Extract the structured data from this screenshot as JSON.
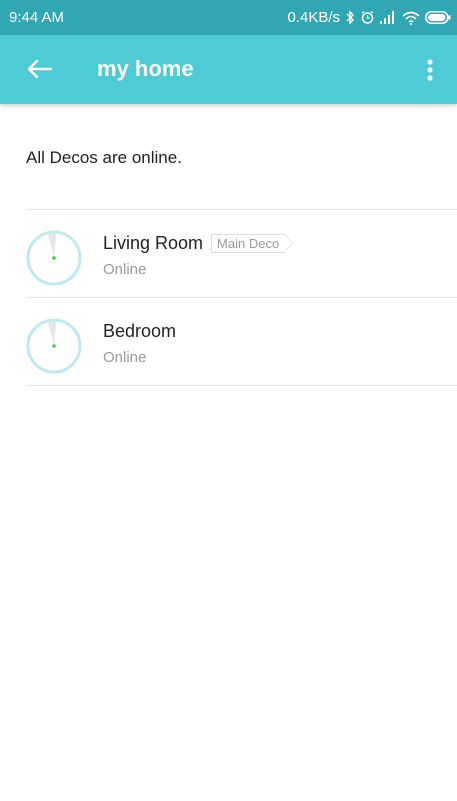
{
  "status_bar": {
    "time": "9:44 AM",
    "network_speed": "0.4KB/s",
    "icons": [
      "bluetooth-icon",
      "alarm-icon",
      "signal-icon",
      "wifi-icon",
      "battery-icon"
    ]
  },
  "app_bar": {
    "title": "my home",
    "back_icon": "arrow-left-icon",
    "menu_icon": "more-vert-icon"
  },
  "network_status": "All Decos are online.",
  "devices": [
    {
      "name": "Living Room",
      "badge": "Main Deco",
      "status": "Online"
    },
    {
      "name": "Bedroom",
      "status": "Online"
    }
  ],
  "colors": {
    "status_bar": "#31a7b4",
    "app_bar": "#4ecbd4",
    "online_dot": "#3ccf3c",
    "device_ring": "#bfe8f1"
  }
}
